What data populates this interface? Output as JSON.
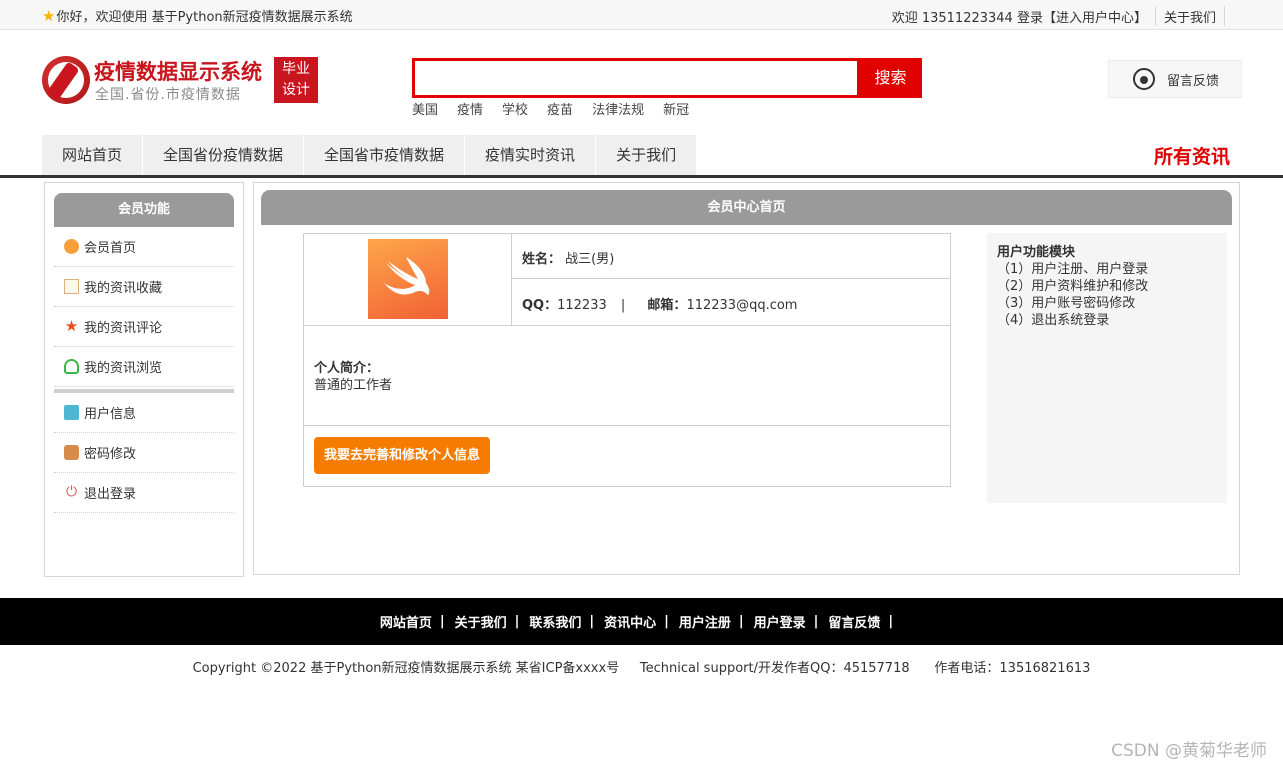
{
  "topbar": {
    "welcome": "你好，欢迎使用 基于Python新冠疫情数据展示系统",
    "user_text": "欢迎 13511223344 登录",
    "user_center": "【进入用户中心】",
    "about": "关于我们"
  },
  "header": {
    "brand_title": "疫情数据显示系统",
    "brand_sub": "全国.省份.市疫情数据",
    "badge_line1": "毕业",
    "badge_line2": "设计",
    "search_value": "",
    "search_button": "搜索",
    "hotwords": [
      "美国",
      "疫情",
      "学校",
      "疫苗",
      "法律法规",
      "新冠"
    ],
    "feedback": "留言反馈"
  },
  "nav": {
    "items": [
      "网站首页",
      "全国省份疫情数据",
      "全国省市疫情数据",
      "疫情实时资讯",
      "关于我们"
    ],
    "right_label": "所有资讯"
  },
  "sidebar": {
    "title": "会员功能",
    "items": [
      "会员首页",
      "我的资讯收藏",
      "我的资讯评论",
      "我的资讯浏览",
      "用户信息",
      "密码修改",
      "退出登录"
    ]
  },
  "main": {
    "title": "会员中心首页",
    "name_label": "姓名：",
    "name_value": "战三(男)",
    "qq_label": "QQ：",
    "qq_value": "112233",
    "contact_sep": "|",
    "email_label": "邮箱：",
    "email_value": "112233@qq.com",
    "intro_label": "个人简介：",
    "intro_value": "普通的工作者",
    "edit_button": "我要去完善和修改个人信息"
  },
  "functions": {
    "title": "用户功能模块",
    "items": [
      "（1）用户注册、用户登录",
      "（2）用户资料维护和修改",
      "（3）用户账号密码修改",
      "（4）退出系统登录"
    ]
  },
  "footer": {
    "links": [
      "网站首页",
      "关于我们",
      "联系我们",
      "资讯中心",
      "用户注册",
      "用户登录",
      "留言反馈"
    ],
    "pipe": "|",
    "copyright": "Copyright ©2022 基于Python新冠疫情数据展示系统 某省ICP备xxxx号     Technical support/开发作者QQ：45157718      作者电话：13516821613"
  },
  "watermark": "CSDN @黄菊华老师",
  "colors": {
    "accent_red": "#e00000",
    "brand_red": "#c9151e",
    "button_orange": "#f57c00",
    "header_gray": "#9a9a9a"
  }
}
